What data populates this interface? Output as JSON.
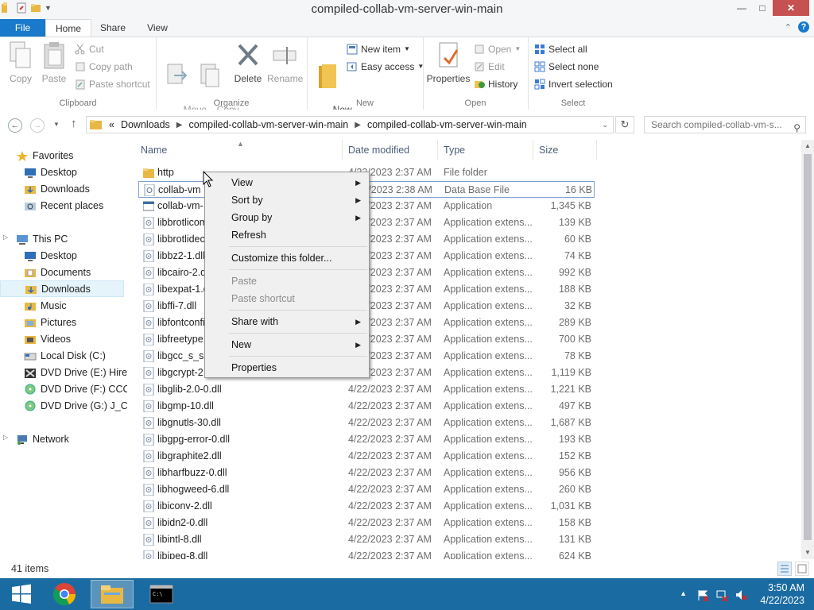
{
  "window": {
    "title": "compiled-collab-vm-server-win-main",
    "controls": {
      "minimize": "—",
      "maximize": "□",
      "close": "✕"
    }
  },
  "ribbon": {
    "tabs": [
      "File",
      "Home",
      "Share",
      "View"
    ],
    "help": "?",
    "clipboard": {
      "label": "Clipboard",
      "copy": "Copy",
      "paste": "Paste",
      "cut": "Cut",
      "copy_path": "Copy path",
      "paste_shortcut": "Paste shortcut"
    },
    "organize": {
      "label": "Organize",
      "move_to": "Move\nto",
      "copy_to": "Copy\nto",
      "delete": "Delete",
      "rename": "Rename"
    },
    "new": {
      "label": "New",
      "new_folder": "New\nfolder",
      "new_item": "New item",
      "easy_access": "Easy access"
    },
    "open": {
      "label": "Open",
      "properties": "Properties",
      "open": "Open",
      "edit": "Edit",
      "history": "History"
    },
    "select": {
      "label": "Select",
      "select_all": "Select all",
      "select_none": "Select none",
      "invert_selection": "Invert selection"
    }
  },
  "address": {
    "overflow": "«",
    "segments": [
      "Downloads",
      "compiled-collab-vm-server-win-main",
      "compiled-collab-vm-server-win-main"
    ],
    "search_placeholder": "Search compiled-collab-vm-s..."
  },
  "nav_pane": {
    "favorites": "Favorites",
    "favorites_items": [
      "Desktop",
      "Downloads",
      "Recent places"
    ],
    "this_pc": "This PC",
    "this_pc_items": [
      "Desktop",
      "Documents",
      "Downloads",
      "Music",
      "Pictures",
      "Videos",
      "Local Disk (C:)",
      "DVD Drive (E:) Hiren",
      "DVD Drive (F:) CCCC",
      "DVD Drive (G:) J_CEN"
    ],
    "network": "Network"
  },
  "columns": {
    "name": "Name",
    "date": "Date modified",
    "type": "Type",
    "size": "Size"
  },
  "files": [
    {
      "name": "http",
      "date": "4/22/2023 2:37 AM",
      "type": "File folder",
      "size": "",
      "icon": "folder-icon"
    },
    {
      "name": "collab-vm",
      "date": "4/22/2023 2:38 AM",
      "type": "Data Base File",
      "size": "16 KB",
      "icon": "database-file-icon"
    },
    {
      "name": "collab-vm-",
      "date": "4/22/2023 2:37 AM",
      "type": "Application",
      "size": "1,345 KB",
      "icon": "application-icon"
    },
    {
      "name": "libbrotlicom",
      "date": "4/22/2023 2:37 AM",
      "type": "Application extens...",
      "size": "139 KB",
      "icon": "dll-file-icon"
    },
    {
      "name": "libbrotlidec",
      "date": "4/22/2023 2:37 AM",
      "type": "Application extens...",
      "size": "60 KB",
      "icon": "dll-file-icon"
    },
    {
      "name": "libbz2-1.dll",
      "date": "4/22/2023 2:37 AM",
      "type": "Application extens...",
      "size": "74 KB",
      "icon": "dll-file-icon"
    },
    {
      "name": "libcairo-2.dll",
      "date": "4/22/2023 2:37 AM",
      "type": "Application extens...",
      "size": "992 KB",
      "icon": "dll-file-icon"
    },
    {
      "name": "libexpat-1.dll",
      "date": "4/22/2023 2:37 AM",
      "type": "Application extens...",
      "size": "188 KB",
      "icon": "dll-file-icon"
    },
    {
      "name": "libffi-7.dll",
      "date": "4/22/2023 2:37 AM",
      "type": "Application extens...",
      "size": "32 KB",
      "icon": "dll-file-icon"
    },
    {
      "name": "libfontconfig",
      "date": "4/22/2023 2:37 AM",
      "type": "Application extens...",
      "size": "289 KB",
      "icon": "dll-file-icon"
    },
    {
      "name": "libfreetype",
      "date": "4/22/2023 2:37 AM",
      "type": "Application extens...",
      "size": "700 KB",
      "icon": "dll-file-icon"
    },
    {
      "name": "libgcc_s_se",
      "date": "4/22/2023 2:37 AM",
      "type": "Application extens...",
      "size": "78 KB",
      "icon": "dll-file-icon"
    },
    {
      "name": "libgcrypt-2",
      "date": "4/22/2023 2:37 AM",
      "type": "Application extens...",
      "size": "1,119 KB",
      "icon": "dll-file-icon"
    },
    {
      "name": "libglib-2.0-0.dll",
      "date": "4/22/2023 2:37 AM",
      "type": "Application extens...",
      "size": "1,221 KB",
      "icon": "dll-file-icon"
    },
    {
      "name": "libgmp-10.dll",
      "date": "4/22/2023 2:37 AM",
      "type": "Application extens...",
      "size": "497 KB",
      "icon": "dll-file-icon"
    },
    {
      "name": "libgnutls-30.dll",
      "date": "4/22/2023 2:37 AM",
      "type": "Application extens...",
      "size": "1,687 KB",
      "icon": "dll-file-icon"
    },
    {
      "name": "libgpg-error-0.dll",
      "date": "4/22/2023 2:37 AM",
      "type": "Application extens...",
      "size": "193 KB",
      "icon": "dll-file-icon"
    },
    {
      "name": "libgraphite2.dll",
      "date": "4/22/2023 2:37 AM",
      "type": "Application extens...",
      "size": "152 KB",
      "icon": "dll-file-icon"
    },
    {
      "name": "libharfbuzz-0.dll",
      "date": "4/22/2023 2:37 AM",
      "type": "Application extens...",
      "size": "956 KB",
      "icon": "dll-file-icon"
    },
    {
      "name": "libhogweed-6.dll",
      "date": "4/22/2023 2:37 AM",
      "type": "Application extens...",
      "size": "260 KB",
      "icon": "dll-file-icon"
    },
    {
      "name": "libiconv-2.dll",
      "date": "4/22/2023 2:37 AM",
      "type": "Application extens...",
      "size": "1,031 KB",
      "icon": "dll-file-icon"
    },
    {
      "name": "libidn2-0.dll",
      "date": "4/22/2023 2:37 AM",
      "type": "Application extens...",
      "size": "158 KB",
      "icon": "dll-file-icon"
    },
    {
      "name": "libintl-8.dll",
      "date": "4/22/2023 2:37 AM",
      "type": "Application extens...",
      "size": "131 KB",
      "icon": "dll-file-icon"
    },
    {
      "name": "libjpeg-8.dll",
      "date": "4/22/2023 2:37 AM",
      "type": "Application extens...",
      "size": "624 KB",
      "icon": "dll-file-icon"
    }
  ],
  "context_menu": [
    {
      "label": "View",
      "submenu": true,
      "enabled": true
    },
    {
      "label": "Sort by",
      "submenu": true,
      "enabled": true
    },
    {
      "label": "Group by",
      "submenu": true,
      "enabled": true
    },
    {
      "label": "Refresh",
      "submenu": false,
      "enabled": true
    },
    {
      "sep": true
    },
    {
      "label": "Customize this folder...",
      "submenu": false,
      "enabled": true
    },
    {
      "sep": true
    },
    {
      "label": "Paste",
      "submenu": false,
      "enabled": false
    },
    {
      "label": "Paste shortcut",
      "submenu": false,
      "enabled": false
    },
    {
      "sep": true
    },
    {
      "label": "Share with",
      "submenu": true,
      "enabled": true
    },
    {
      "sep": true
    },
    {
      "label": "New",
      "submenu": true,
      "enabled": true
    },
    {
      "sep": true
    },
    {
      "label": "Properties",
      "submenu": false,
      "enabled": true
    }
  ],
  "status": {
    "item_count": "41 items"
  },
  "taskbar": {
    "items": [
      "start-button",
      "chrome-icon",
      "file-explorer-icon",
      "command-prompt-icon"
    ],
    "time": "3:50 AM",
    "date": "4/22/2023"
  },
  "colors": {
    "accent": "#1979ca",
    "taskbar": "#1b6ba3",
    "selection": "#e5f3fb"
  }
}
